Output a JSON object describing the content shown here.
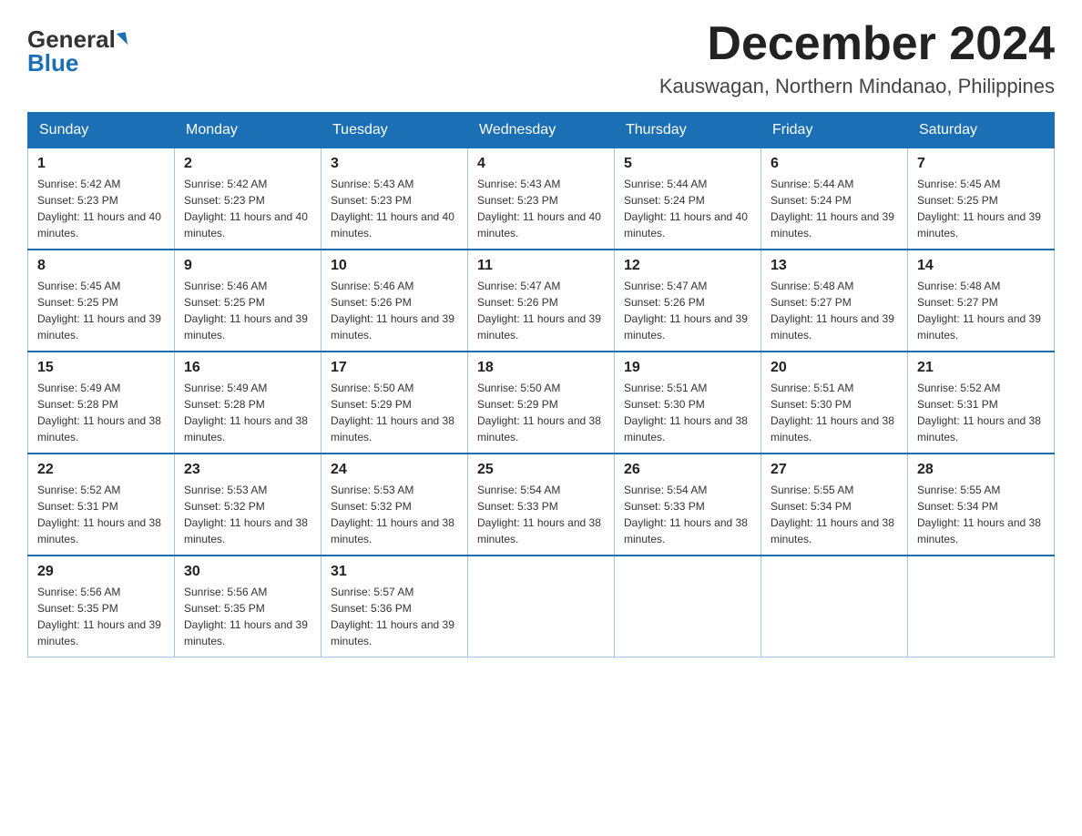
{
  "header": {
    "logo_general": "General",
    "logo_blue": "Blue",
    "month_title": "December 2024",
    "location": "Kauswagan, Northern Mindanao, Philippines"
  },
  "weekdays": [
    "Sunday",
    "Monday",
    "Tuesday",
    "Wednesday",
    "Thursday",
    "Friday",
    "Saturday"
  ],
  "weeks": [
    [
      {
        "day": "1",
        "sunrise": "5:42 AM",
        "sunset": "5:23 PM",
        "daylight": "11 hours and 40 minutes."
      },
      {
        "day": "2",
        "sunrise": "5:42 AM",
        "sunset": "5:23 PM",
        "daylight": "11 hours and 40 minutes."
      },
      {
        "day": "3",
        "sunrise": "5:43 AM",
        "sunset": "5:23 PM",
        "daylight": "11 hours and 40 minutes."
      },
      {
        "day": "4",
        "sunrise": "5:43 AM",
        "sunset": "5:23 PM",
        "daylight": "11 hours and 40 minutes."
      },
      {
        "day": "5",
        "sunrise": "5:44 AM",
        "sunset": "5:24 PM",
        "daylight": "11 hours and 40 minutes."
      },
      {
        "day": "6",
        "sunrise": "5:44 AM",
        "sunset": "5:24 PM",
        "daylight": "11 hours and 39 minutes."
      },
      {
        "day": "7",
        "sunrise": "5:45 AM",
        "sunset": "5:25 PM",
        "daylight": "11 hours and 39 minutes."
      }
    ],
    [
      {
        "day": "8",
        "sunrise": "5:45 AM",
        "sunset": "5:25 PM",
        "daylight": "11 hours and 39 minutes."
      },
      {
        "day": "9",
        "sunrise": "5:46 AM",
        "sunset": "5:25 PM",
        "daylight": "11 hours and 39 minutes."
      },
      {
        "day": "10",
        "sunrise": "5:46 AM",
        "sunset": "5:26 PM",
        "daylight": "11 hours and 39 minutes."
      },
      {
        "day": "11",
        "sunrise": "5:47 AM",
        "sunset": "5:26 PM",
        "daylight": "11 hours and 39 minutes."
      },
      {
        "day": "12",
        "sunrise": "5:47 AM",
        "sunset": "5:26 PM",
        "daylight": "11 hours and 39 minutes."
      },
      {
        "day": "13",
        "sunrise": "5:48 AM",
        "sunset": "5:27 PM",
        "daylight": "11 hours and 39 minutes."
      },
      {
        "day": "14",
        "sunrise": "5:48 AM",
        "sunset": "5:27 PM",
        "daylight": "11 hours and 39 minutes."
      }
    ],
    [
      {
        "day": "15",
        "sunrise": "5:49 AM",
        "sunset": "5:28 PM",
        "daylight": "11 hours and 38 minutes."
      },
      {
        "day": "16",
        "sunrise": "5:49 AM",
        "sunset": "5:28 PM",
        "daylight": "11 hours and 38 minutes."
      },
      {
        "day": "17",
        "sunrise": "5:50 AM",
        "sunset": "5:29 PM",
        "daylight": "11 hours and 38 minutes."
      },
      {
        "day": "18",
        "sunrise": "5:50 AM",
        "sunset": "5:29 PM",
        "daylight": "11 hours and 38 minutes."
      },
      {
        "day": "19",
        "sunrise": "5:51 AM",
        "sunset": "5:30 PM",
        "daylight": "11 hours and 38 minutes."
      },
      {
        "day": "20",
        "sunrise": "5:51 AM",
        "sunset": "5:30 PM",
        "daylight": "11 hours and 38 minutes."
      },
      {
        "day": "21",
        "sunrise": "5:52 AM",
        "sunset": "5:31 PM",
        "daylight": "11 hours and 38 minutes."
      }
    ],
    [
      {
        "day": "22",
        "sunrise": "5:52 AM",
        "sunset": "5:31 PM",
        "daylight": "11 hours and 38 minutes."
      },
      {
        "day": "23",
        "sunrise": "5:53 AM",
        "sunset": "5:32 PM",
        "daylight": "11 hours and 38 minutes."
      },
      {
        "day": "24",
        "sunrise": "5:53 AM",
        "sunset": "5:32 PM",
        "daylight": "11 hours and 38 minutes."
      },
      {
        "day": "25",
        "sunrise": "5:54 AM",
        "sunset": "5:33 PM",
        "daylight": "11 hours and 38 minutes."
      },
      {
        "day": "26",
        "sunrise": "5:54 AM",
        "sunset": "5:33 PM",
        "daylight": "11 hours and 38 minutes."
      },
      {
        "day": "27",
        "sunrise": "5:55 AM",
        "sunset": "5:34 PM",
        "daylight": "11 hours and 38 minutes."
      },
      {
        "day": "28",
        "sunrise": "5:55 AM",
        "sunset": "5:34 PM",
        "daylight": "11 hours and 38 minutes."
      }
    ],
    [
      {
        "day": "29",
        "sunrise": "5:56 AM",
        "sunset": "5:35 PM",
        "daylight": "11 hours and 39 minutes."
      },
      {
        "day": "30",
        "sunrise": "5:56 AM",
        "sunset": "5:35 PM",
        "daylight": "11 hours and 39 minutes."
      },
      {
        "day": "31",
        "sunrise": "5:57 AM",
        "sunset": "5:36 PM",
        "daylight": "11 hours and 39 minutes."
      },
      null,
      null,
      null,
      null
    ]
  ]
}
